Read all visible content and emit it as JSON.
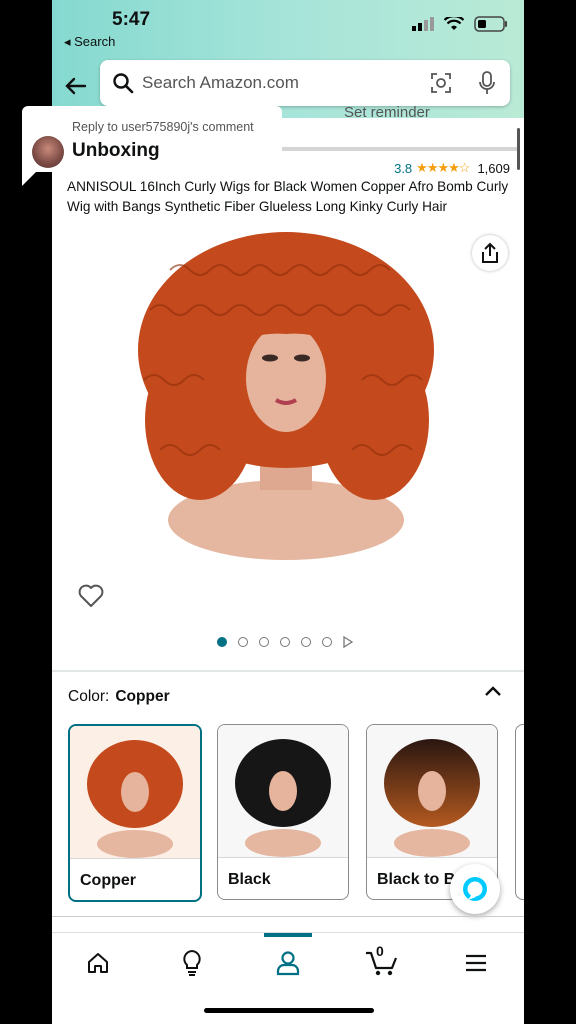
{
  "status_bar": {
    "time": "5:47",
    "back_app": "Search"
  },
  "search": {
    "placeholder": "Search Amazon.com"
  },
  "comment": {
    "reply_to": "Reply to user575890j's comment",
    "title": "Unboxing"
  },
  "hidden_banner": "Set reminder",
  "product": {
    "rating": "3.8",
    "stars": "★★★★☆",
    "rating_count": "1,609",
    "title": "ANNISOUL 16Inch Curly Wigs for Black Women Copper Afro Bomb Curly Wig with Bangs Synthetic Fiber Glueless Long Kinky Curly Hair"
  },
  "color_selector": {
    "label": "Color:",
    "selected": "Copper",
    "options": [
      {
        "label": "Copper",
        "hair_color": "#c4491c"
      },
      {
        "label": "Black",
        "hair_color": "#161616"
      },
      {
        "label": "Black to B",
        "hair_color": "#8a4418"
      }
    ]
  },
  "colors": {
    "accent": "#007185",
    "star": "#f59e0b",
    "hair": "#c4491c"
  },
  "icons": [
    "back-arrow-icon",
    "search-icon",
    "camera-scan-icon",
    "microphone-icon",
    "share-icon",
    "heart-icon",
    "chevron-up-icon",
    "alexa-icon",
    "home-icon",
    "lightbulb-icon",
    "account-icon",
    "cart-icon",
    "menu-icon"
  ],
  "tab_bar": {
    "cart_count": "0",
    "active": "account"
  },
  "image_dots": {
    "count": 6,
    "active_index": 0
  }
}
